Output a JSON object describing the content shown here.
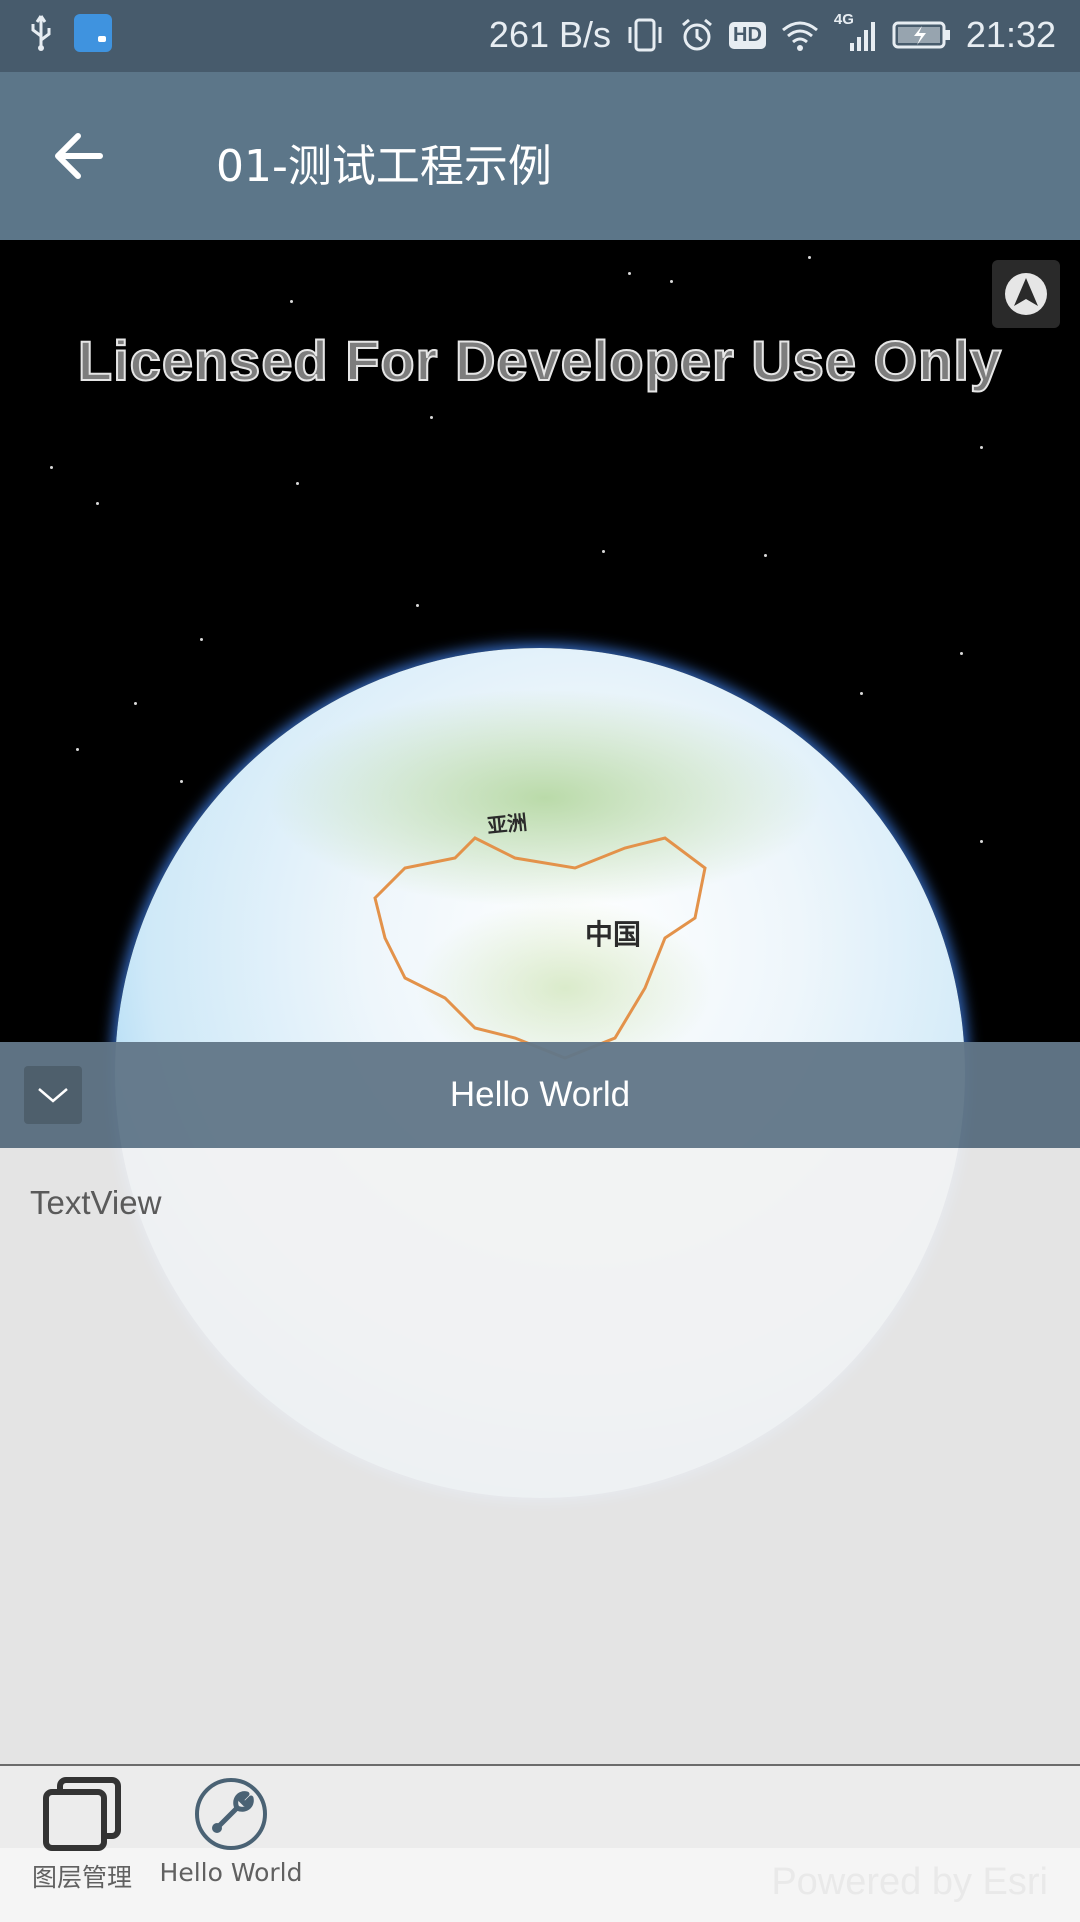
{
  "status_bar": {
    "net_speed": "261 B/s",
    "hd_label": "HD",
    "network_type": "4G",
    "time": "21:32"
  },
  "app_bar": {
    "title": "01-测试工程示例"
  },
  "map": {
    "watermark": "Licensed For Developer Use Only",
    "label_asia": "亚洲",
    "label_china": "中国"
  },
  "panel": {
    "title": "Hello World",
    "body_text": "TextView"
  },
  "bottom_tabs": [
    {
      "label": "图层管理",
      "icon": "layers-icon"
    },
    {
      "label": "Hello World",
      "icon": "wrench-icon"
    }
  ],
  "footer": {
    "powered_text": "Powered by Esri"
  },
  "colors": {
    "status_bar": "#475b6c",
    "app_bar": "#5c7689",
    "panel_header": "#627788",
    "panel_body": "#f2f2f2"
  }
}
